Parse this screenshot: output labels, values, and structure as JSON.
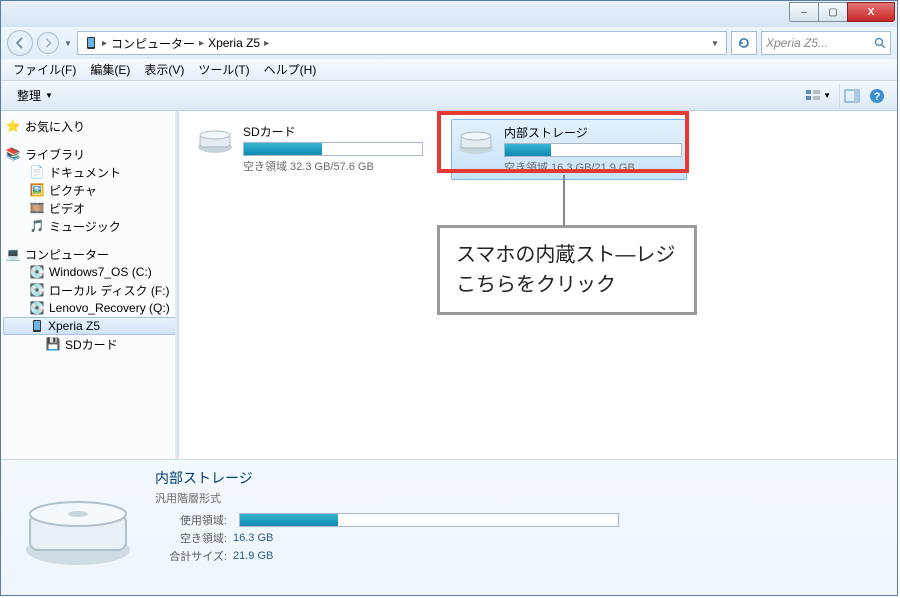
{
  "titlebar": {
    "minimize": "–",
    "maximize": "▢",
    "close": "X"
  },
  "nav": {
    "breadcrumb": {
      "root": "コンピューター",
      "current": "Xperia Z5"
    },
    "search_placeholder": "Xperia Z5..."
  },
  "menubar": {
    "file": "ファイル(F)",
    "edit": "編集(E)",
    "view": "表示(V)",
    "tools": "ツール(T)",
    "help": "ヘルプ(H)"
  },
  "toolbar": {
    "organize": "整理"
  },
  "tree": {
    "favorites": "お気に入り",
    "libraries": "ライブラリ",
    "documents": "ドキュメント",
    "pictures": "ピクチャ",
    "videos": "ビデオ",
    "music": "ミュージック",
    "computer": "コンピューター",
    "win7": "Windows7_OS (C:)",
    "local": "ローカル ディスク (F:)",
    "lenovo": "Lenovo_Recovery (Q:)",
    "xperia": "Xperia Z5",
    "sdcard": "SDカード"
  },
  "drives": {
    "sd": {
      "name": "SDカード",
      "free": "空き領域 32.3 GB/57.6 GB",
      "fill_pct": 44
    },
    "internal": {
      "name": "内部ストレージ",
      "free": "空き領域 16.3 GB/21.9 GB",
      "fill_pct": 26
    }
  },
  "callout": {
    "line1": "スマホの内蔵スト―レジ",
    "line2": "こちらをクリック"
  },
  "details": {
    "title": "内部ストレージ",
    "type": "汎用階層形式",
    "used_label": "使用領域:",
    "free_label": "空き領域:",
    "free_val": "16.3 GB",
    "total_label": "合計サイズ:",
    "total_val": "21.9 GB",
    "bar_fill_pct": 26
  }
}
